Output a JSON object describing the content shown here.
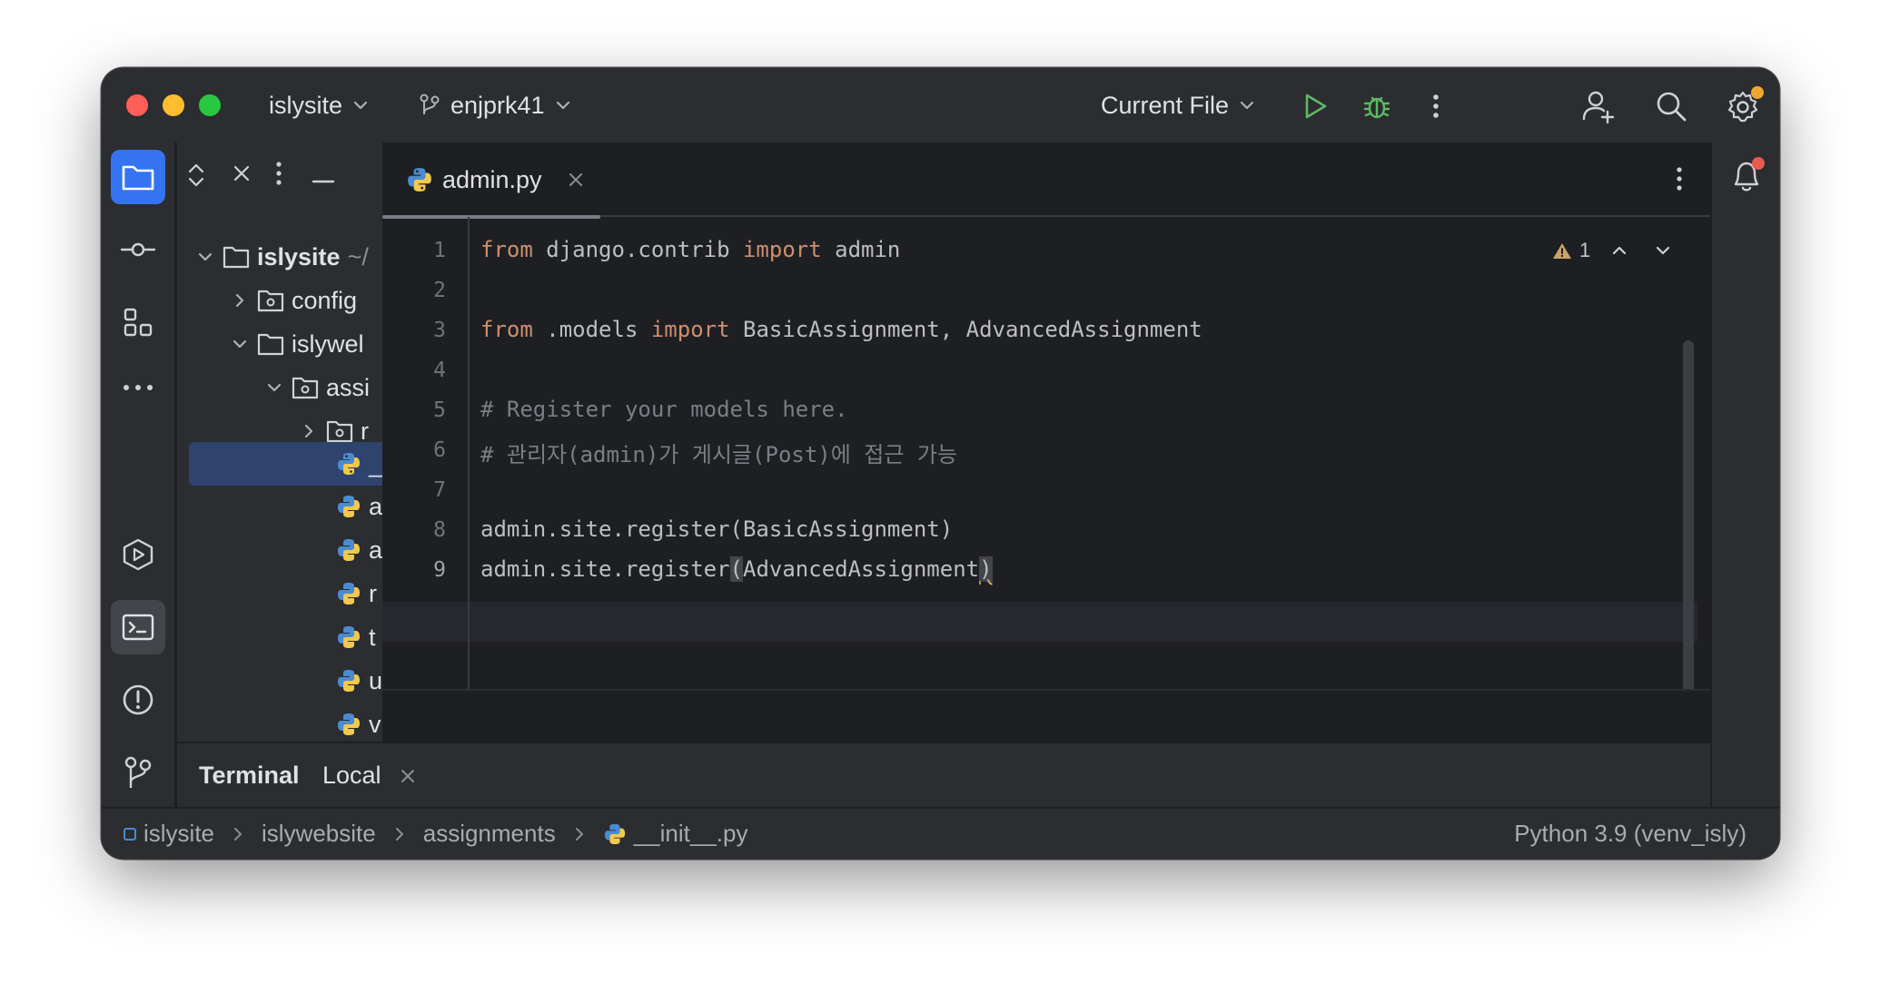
{
  "titlebar": {
    "project": "islysite",
    "branch": "enjprk41",
    "run_config": "Current File"
  },
  "project_tree": {
    "root_name": "islysite",
    "root_suffix": "~/",
    "items": [
      {
        "label": "config"
      },
      {
        "label": "islywel"
      },
      {
        "label": "assi"
      },
      {
        "label": "r"
      },
      {
        "label": "_"
      },
      {
        "label": "a"
      },
      {
        "label": "a"
      },
      {
        "label": "r"
      },
      {
        "label": "t"
      },
      {
        "label": "u"
      },
      {
        "label": "v"
      }
    ]
  },
  "editor": {
    "tab_label": "admin.py",
    "warning_count": "1",
    "line_numbers": [
      "1",
      "2",
      "3",
      "4",
      "5",
      "6",
      "7",
      "8",
      "9"
    ],
    "lines": {
      "l1_from": "from",
      "l1_module": " django.contrib ",
      "l1_import": "import",
      "l1_name": " admin",
      "l3_from": "from",
      "l3_module": " .models ",
      "l3_import": "import",
      "l3_names": " BasicAssignment, AdvancedAssignment",
      "l5_comment": "# Register your models here.",
      "l6_comment": "# 관리자(admin)가 게시글(Post)에 접근 가능",
      "l8_code": "admin.site.register(BasicAssignment)",
      "l9_prefix": "admin.site.register",
      "l9_open": "(",
      "l9_arg": "AdvancedAssignment",
      "l9_close": ")"
    }
  },
  "terminal": {
    "title": "Terminal",
    "tab": "Local"
  },
  "statusbar": {
    "crumbs": [
      "islysite",
      "islywebsite",
      "assignments",
      "__init__.py"
    ],
    "interpreter": "Python 3.9 (venv_isly)"
  },
  "colors": {
    "accent": "#3574f0",
    "run_green": "#5fb865",
    "keyword": "#cf8e6d",
    "comment": "#7a7e85"
  }
}
